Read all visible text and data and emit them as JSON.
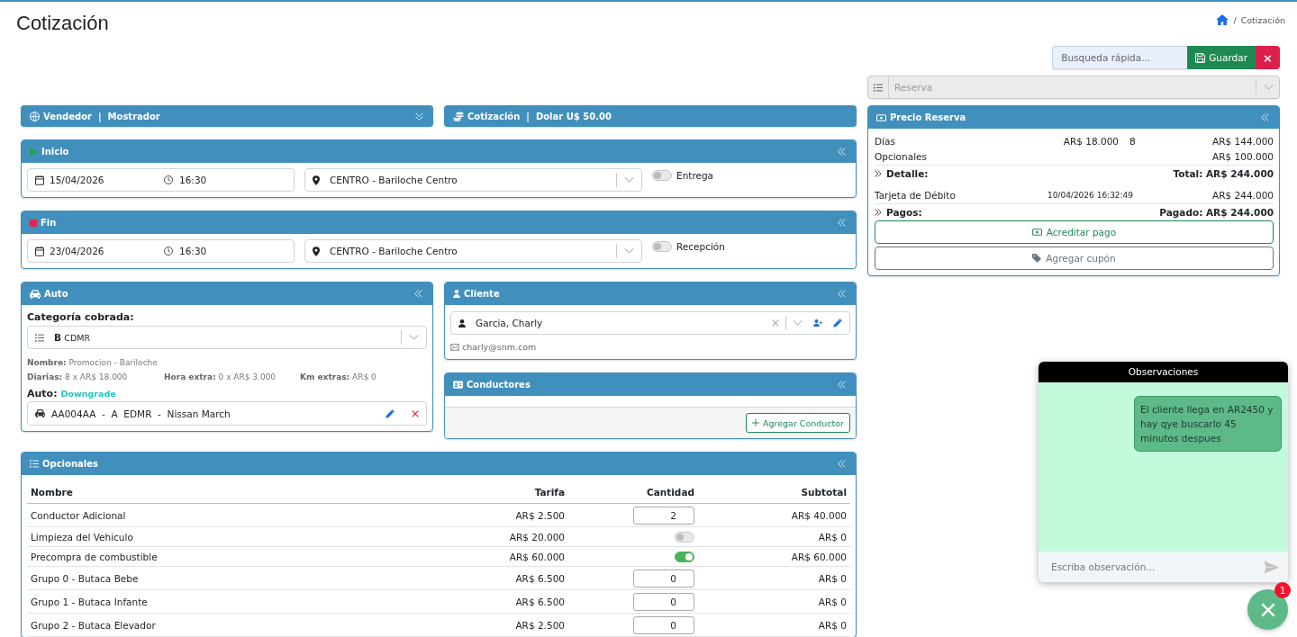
{
  "header": {
    "title": "Cotización",
    "breadcrumb": {
      "separator": "/",
      "current": "Cotización"
    }
  },
  "toolbar": {
    "search": {
      "placeholder": "Busqueda rápida..."
    },
    "save_button": "Guardar",
    "close_button": "×"
  },
  "reservation_select": {
    "placeholder": "Reserva",
    "disabled": true
  },
  "seller_panel": {
    "title": "Vendedor  |  Mostrador",
    "expanded": false
  },
  "rate_panel": {
    "title": "Cotización  |  Dolar U$ 50.00"
  },
  "periods": [
    {
      "kind": "start",
      "title": "Inicio",
      "expanded": true,
      "date": "15/04/2026",
      "time": "16:30",
      "location": "CENTRO - Bariloche Centro",
      "switch": {
        "label": "Entrega",
        "on": false
      }
    },
    {
      "kind": "end",
      "title": "Fin",
      "expanded": true,
      "date": "23/04/2026",
      "time": "16:30",
      "location": "CENTRO - Bariloche Centro",
      "switch": {
        "label": "Recepción",
        "on": false
      }
    }
  ],
  "car_panel": {
    "title": "Auto",
    "expanded": true,
    "category_label": "Categoría cobrada:",
    "category": {
      "code": "B",
      "name": "CDMR"
    },
    "name_detail": "**Nombre:** Promocion - Bariloche",
    "rate_details": [
      "**Diarias:** 8 x AR$ 18.000",
      "**Hora extra:** 0 x AR$ 3.000",
      "**Km extras:** AR$ 0"
    ],
    "car_label": "Auto:",
    "car_status": "Downgrade",
    "car": "AA004AA  -  A  EDMR  -  Nissan March"
  },
  "client_panel": {
    "title": "Cliente",
    "expanded": true,
    "client": "Garcia, Charly",
    "email": "charly@snm.com"
  },
  "drivers_panel": {
    "title": "Conductores",
    "expanded": true,
    "add_button": "Agregar Conductor"
  },
  "extras_panel": {
    "title": "Opcionales",
    "expanded": true,
    "columns": [
      "Nombre",
      "Tarifa",
      "Cantidad",
      "Subtotal"
    ],
    "rows": [
      {
        "name": "Conductor Adicional",
        "rate": "AR$ 2.500",
        "quantity": {
          "kind": "number",
          "value": "2"
        },
        "subtotal": "AR$ 40.000"
      },
      {
        "name": "Limpieza del Vehiculo",
        "rate": "AR$ 20.000",
        "quantity": {
          "kind": "switch",
          "on": false
        },
        "subtotal": "AR$ 0"
      },
      {
        "name": "Precompra de combustible",
        "rate": "AR$ 60.000",
        "quantity": {
          "kind": "switch",
          "on": true
        },
        "subtotal": "AR$ 60.000"
      },
      {
        "name": "Grupo 0 - Butaca Bebe",
        "rate": "AR$ 6.500",
        "quantity": {
          "kind": "number",
          "value": "0"
        },
        "subtotal": "AR$ 0"
      },
      {
        "name": "Grupo 1 - Butaca Infante",
        "rate": "AR$ 6.500",
        "quantity": {
          "kind": "number",
          "value": "0"
        },
        "subtotal": "AR$ 0"
      },
      {
        "name": "Grupo 2 - Butaca Elevador",
        "rate": "AR$ 2.500",
        "quantity": {
          "kind": "number",
          "value": "0"
        },
        "subtotal": "AR$ 0"
      }
    ]
  },
  "price_panel": {
    "title": "Precio Reserva",
    "expanded": true,
    "charges": [
      {
        "label": "Días",
        "rate": "AR$ 18.000",
        "quantity": "8",
        "amount": "AR$ 144.000"
      },
      {
        "label": "Opcionales",
        "amount": "AR$ 100.000"
      }
    ],
    "charges_summary": {
      "label": "Detalle:",
      "total": "Total: AR$ 244.000"
    },
    "payments": [
      {
        "method": "Tarjeta de Débito",
        "date": "10/04/2026 16:32:49",
        "amount": "AR$ 244.000"
      }
    ],
    "payments_summary": {
      "label": "Pagos:",
      "total": "Pagado: AR$ 244.000"
    },
    "buttons": [
      {
        "kind": "credit",
        "label": "Acreditar pago"
      },
      {
        "kind": "coupon",
        "label": "Agregar cupón"
      }
    ]
  },
  "observations": {
    "title": "Observaciones",
    "messages": [
      {
        "text": "El cliente llega en AR2450 y hay qye buscarlo 45 minutos despues"
      }
    ],
    "input": {
      "placeholder": "Escriba observación..."
    },
    "badge": "1"
  }
}
